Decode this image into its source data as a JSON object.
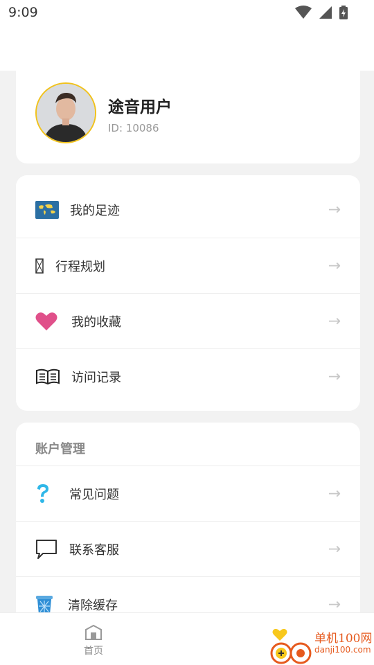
{
  "status_bar": {
    "time": "9:09"
  },
  "profile": {
    "name": "途音用户",
    "id_text": "ID: 10086"
  },
  "menu_primary": [
    {
      "label": "我的足迹",
      "icon": "world-map-icon"
    },
    {
      "label": "行程规划",
      "icon": "missing-glyph-icon"
    },
    {
      "label": "我的收藏",
      "icon": "heart-icon"
    },
    {
      "label": "访问记录",
      "icon": "open-book-icon"
    }
  ],
  "account_section": {
    "title": "账户管理",
    "items": [
      {
        "label": "常见问题",
        "icon": "question-mark-icon"
      },
      {
        "label": "联系客服",
        "icon": "speech-bubble-icon"
      },
      {
        "label": "清除缓存",
        "icon": "trash-can-icon"
      }
    ]
  },
  "arrow_glyph": "→",
  "bottom_nav": {
    "home_label": "首页"
  },
  "watermark": {
    "title": "单机100网",
    "url": "danji100.com"
  },
  "colors": {
    "heart": "#e0508a",
    "question": "#2fb7e8",
    "avatar_border": "#f1c21b",
    "watermark": "#e65a1e"
  }
}
